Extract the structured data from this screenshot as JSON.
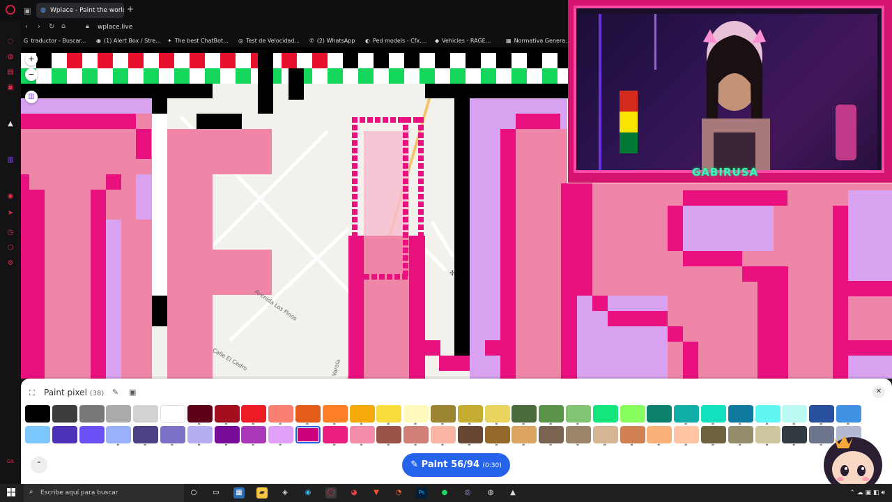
{
  "browser": {
    "tab_title": "Wplace - Paint the world",
    "url": "wplace.live",
    "bookmarks": [
      {
        "label": "traductor - Buscar...",
        "icon": "G"
      },
      {
        "label": "(1) Alert Box / Stre...",
        "icon": "◉"
      },
      {
        "label": "The best ChatBot...",
        "icon": "✦"
      },
      {
        "label": "Test de Velocidad...",
        "icon": "◎"
      },
      {
        "label": "(2) WhatsApp",
        "icon": "✆"
      },
      {
        "label": "Ped models - Cfx....",
        "icon": "◐"
      },
      {
        "label": "Vehicles - RAGE...",
        "icon": "◆"
      },
      {
        "label": "Normativa Genera...",
        "icon": "▦"
      }
    ]
  },
  "map": {
    "streets": [
      "Avenida Los Pinos",
      "Calle El Cedro",
      "Varela"
    ]
  },
  "stream": {
    "streamer_name": "GABIRUSA"
  },
  "panel": {
    "title": "Paint pixel",
    "count": "(38)",
    "paint_label": "Paint",
    "paint_progress": "56/94",
    "paint_timer": "(0:30)"
  },
  "palette": {
    "colors": [
      "#000000",
      "#3c3c3c",
      "#787878",
      "#aaaaaa",
      "#d2d2d2",
      "#ffffff",
      "#600018",
      "#a50e1e",
      "#ed1c24",
      "#fa8072",
      "#e45c1a",
      "#ff7f27",
      "#f6aa09",
      "#f9dd3b",
      "#fffabc",
      "#9c8431",
      "#c5ad31",
      "#e8d45f",
      "#4a6b3a",
      "#5a944a",
      "#84c573",
      "#13e67b",
      "#87ff5e",
      "#0c816e",
      "#10aea6",
      "#13e1be",
      "#0f799f",
      "#60f7f2",
      "#bbfaf2",
      "#28509e",
      "#4093e4",
      "#7dc7ff",
      "#4d31b8",
      "#6b50f6",
      "#99b1fb",
      "#4a4284",
      "#7a71c4",
      "#b5aef1",
      "#780c99",
      "#aa38b9",
      "#e09ff9",
      "#cb007a",
      "#ec1f80",
      "#f38da9",
      "#9b5249",
      "#d18078",
      "#fab6a4",
      "#684634",
      "#95682a",
      "#dba463",
      "#7b6352",
      "#9c846b",
      "#d6b594",
      "#d18051",
      "#f8b277",
      "#ffc5a5",
      "#6d643f",
      "#948c6b",
      "#cdc59e",
      "#333941",
      "#6d758d",
      "#b3b9d1"
    ],
    "selected_index": 41,
    "locked": [
      34,
      35,
      36,
      37,
      38,
      39,
      40,
      42,
      43,
      44,
      45,
      46,
      47,
      48,
      49,
      50,
      51,
      52,
      53,
      54,
      55,
      56,
      57,
      58,
      59,
      60,
      61,
      15,
      16,
      17,
      18,
      19,
      20,
      24,
      25,
      26,
      27,
      28,
      29,
      30,
      10,
      11,
      12,
      13,
      14,
      8,
      9,
      6,
      7
    ]
  },
  "taskbar": {
    "search_placeholder": "Escribe aquí para buscar"
  }
}
